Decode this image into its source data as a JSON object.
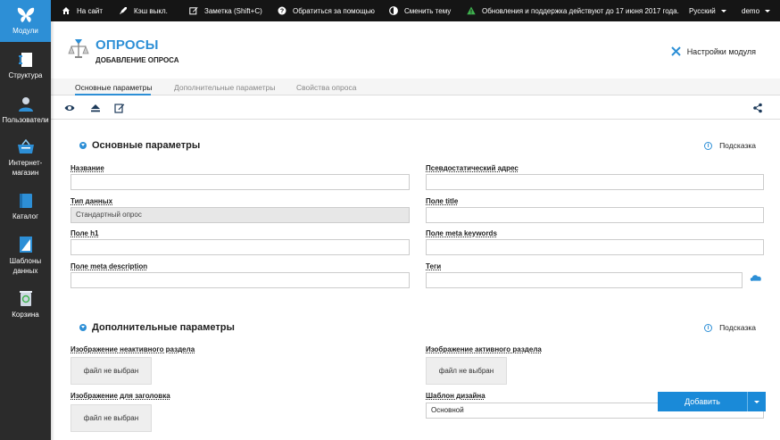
{
  "topbar": {
    "site": "На сайт",
    "cache": "Кэш выкл.",
    "note": "Заметка (Shift+C)",
    "help": "Обратиться за помощью",
    "theme": "Сменить тему",
    "updates": "Обновления и поддержка действуют до 17 июня 2017 года.",
    "language": "Русский",
    "user": "demo"
  },
  "sidebar": {
    "items": [
      {
        "label": "Модули",
        "icon": "butterfly-icon",
        "active": true
      },
      {
        "label": "Структура",
        "icon": "structure-icon"
      },
      {
        "label": "Пользователи",
        "icon": "users-icon"
      },
      {
        "label": "Интернет-магазин",
        "icon": "shop-basket-icon"
      },
      {
        "label": "Каталог",
        "icon": "catalog-book-icon"
      },
      {
        "label": "Шаблоны данных",
        "icon": "data-templates-icon"
      },
      {
        "label": "Корзина",
        "icon": "trash-bin-icon"
      }
    ]
  },
  "header": {
    "title": "ОПРОСЫ",
    "subtitle": "ДОБАВЛЕНИЕ ОПРОСА",
    "settings": "Настройки модуля"
  },
  "tabs": [
    "Основные параметры",
    "Дополнительные параметры",
    "Свойства опроса"
  ],
  "section1": {
    "title": "Основные параметры",
    "hint": "Подсказка",
    "fields": {
      "name_label": "Название",
      "name_value": "",
      "pseudo_label": "Псевдостатический адрес",
      "pseudo_value": "",
      "type_label": "Тип данных",
      "type_value": "Стандартный опрос",
      "title_label": "Поле title",
      "title_value": "",
      "h1_label": "Поле h1",
      "h1_value": "",
      "keywords_label": "Поле meta keywords",
      "keywords_value": "",
      "description_label": "Поле meta description",
      "description_value": "",
      "tags_label": "Теги",
      "tags_value": ""
    }
  },
  "section2": {
    "title": "Дополнительные параметры",
    "hint": "Подсказка",
    "inactive_image_label": "Изображение неактивного раздела",
    "active_image_label": "Изображение активного раздела",
    "header_image_label": "Изображение для заголовка",
    "design_template_label": "Шаблон дизайна",
    "design_template_value": "Основной",
    "file_not_selected": "файл не выбран"
  },
  "actions": {
    "add": "Добавить"
  },
  "colors": {
    "accent": "#2d8fd6",
    "topbar_bg": "#151515",
    "sidebar_bg": "#2b2b2b",
    "add_button": "#1a8ad8"
  }
}
